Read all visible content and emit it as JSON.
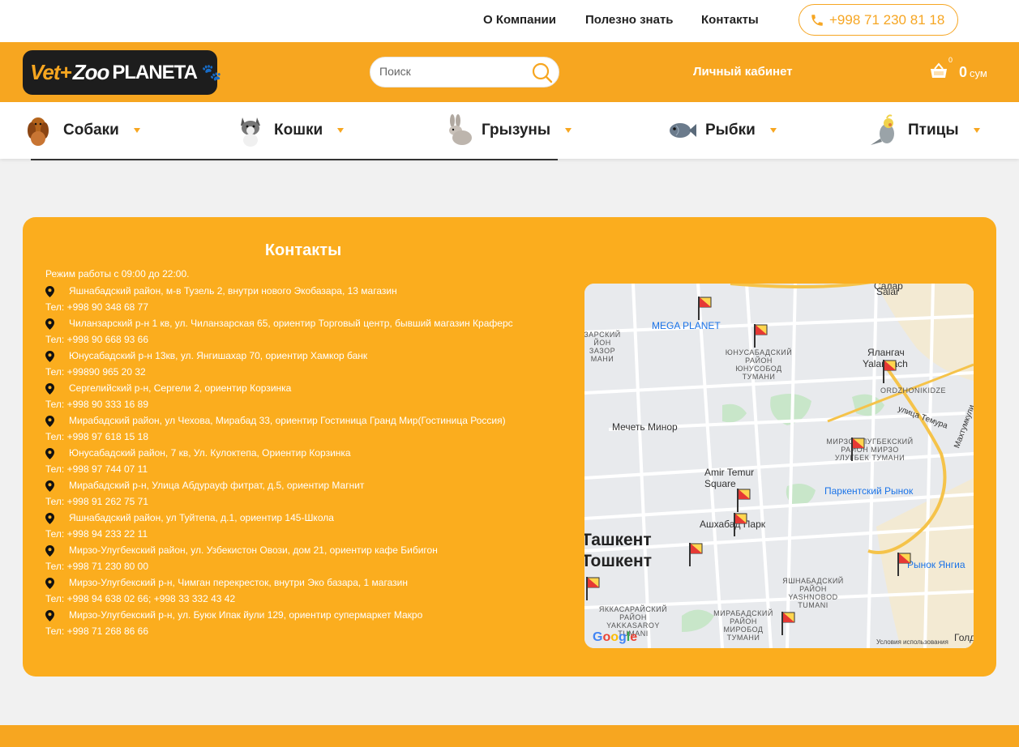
{
  "topnav": {
    "about": "О Компании",
    "useful": "Полезно знать",
    "contacts": "Контакты",
    "phone": "+998 71 230 81 18"
  },
  "header": {
    "logo": {
      "vet": "Vet+",
      "zoo": "Zoo",
      "planeta": "PLANETA"
    },
    "search_placeholder": "Поиск",
    "cabinet": "Личный кабинет",
    "cart_count": "0",
    "cart_total": "0",
    "cart_currency": "сум"
  },
  "categories": [
    {
      "label": "Собаки",
      "icon": "dog-icon"
    },
    {
      "label": "Кошки",
      "icon": "cat-icon"
    },
    {
      "label": "Грызуны",
      "icon": "rabbit-icon"
    },
    {
      "label": "Рыбки",
      "icon": "fish-icon"
    },
    {
      "label": "Птицы",
      "icon": "bird-icon"
    }
  ],
  "contacts": {
    "title": "Контакты",
    "hours": "Режим работы с 09:00 до 22:00.",
    "addresses": [
      {
        "address": "Яшнабадский район, м-в Тузель 2, внутри нового Экобазара, 13 магазин",
        "phone": "Тел: +998 90 348 68 77"
      },
      {
        "address": "Чиланзарский р-н 1 кв, ул. Чиланзарская 65, ориентир Торговый центр, бывший магазин Краферс",
        "phone": "Тел: +998 90 668 93 66"
      },
      {
        "address": "Юнусабадский р-н 13кв, ул. Янгишахар 70, ориентир Хамкор банк",
        "phone": "Тел: +99890 965 20 32"
      },
      {
        "address": "Сергелийский р-н, Сергели 2, ориентир Корзинка",
        "phone": "Тел: +998 90 333 16 89"
      },
      {
        "address": "Мирабадский район, ул Чехова, Мирабад 33, ориентир Гостиница Гранд Мир(Гостиница Россия)",
        "phone": "Тел: +998 97 618 15 18"
      },
      {
        "address": "Юнусабадский район, 7 кв, Ул. Кулоктепа, Ориентир Корзинка",
        "phone": "Тел: +998 97 744 07 11"
      },
      {
        "address": "Мирабадский р-н, Улица Абдурауф фитрат, д.5, ориентир Магнит",
        "phone": "Тел: +998 91 262 75 71"
      },
      {
        "address": "Яшнабадский район, ул Туйтепа, д.1, ориентир 145-Школа",
        "phone": "Тел: +998 94 233 22 11"
      },
      {
        "address": "Мирзо-Улугбекский район, ул. Узбекистон Овози, дом 21, ориентир кафе Бибигон",
        "phone": "Тел: +998 71 230 80 00"
      },
      {
        "address": "Мирзо-Улугбекский р-н, Чимган перекресток, внутри Эко базара, 1 магазин",
        "phone": "Тел: +998 94 638 02 66; +998 33 332 43 42"
      },
      {
        "address": "Мирзо-Улугбекский р-н, ул. Буюк Ипак йули 129, ориентир супермаркет Макро",
        "phone": "Тел: +998 71 268 86 66"
      }
    ]
  },
  "map": {
    "labels": {
      "salar": "Салар",
      "salar_lat": "Salar",
      "mega_planet": "MEGA PLANET",
      "yalangach": "Ялангач",
      "yalangach_lat": "Yalangach",
      "ordzhonikidze": "ORDZHONIKIDZE",
      "temura": "улица Темура",
      "mosque": "Мечеть Минор",
      "amir_temur": "Amir Temur Square",
      "ashkhabad": "Ашхабад Парк",
      "parkent": "Паркентский Рынок",
      "yangiabad": "Рынок Янгиа",
      "tashkent_ru": "Ташкент",
      "tashkent_uz": "Тошкент",
      "golden": "Голде",
      "terms": "Условия использования",
      "mahtumkuli": "Махтумкули"
    },
    "districts": {
      "yunusabad": "ЮНУСАБАДСКИЙ РАЙОН ЮНУСОБОД ТУМАНИ",
      "mirzo": "МИРЗО-УЛУГБЕКСКИЙ РАЙОН МИРЗО УЛУГБЕК ТУМАНИ",
      "yashnabad": "ЯШНАБАДСКИЙ РАЙОН YASHNOBOD TUMANI",
      "mirabad": "МИРАБАДСКИЙ РАЙОН МИРОБОД ТУМАНИ",
      "yakkasaray": "ЯККАСАРАЙСКИЙ РАЙОН YAKKASAROY TUMANI",
      "left": "ЗАРСКИЙ ЙОН ЗАЗОР МАНИ"
    },
    "google_logo": "Google"
  },
  "colors": {
    "accent": "#f7a620",
    "contacts_bg": "#fbad1e"
  }
}
